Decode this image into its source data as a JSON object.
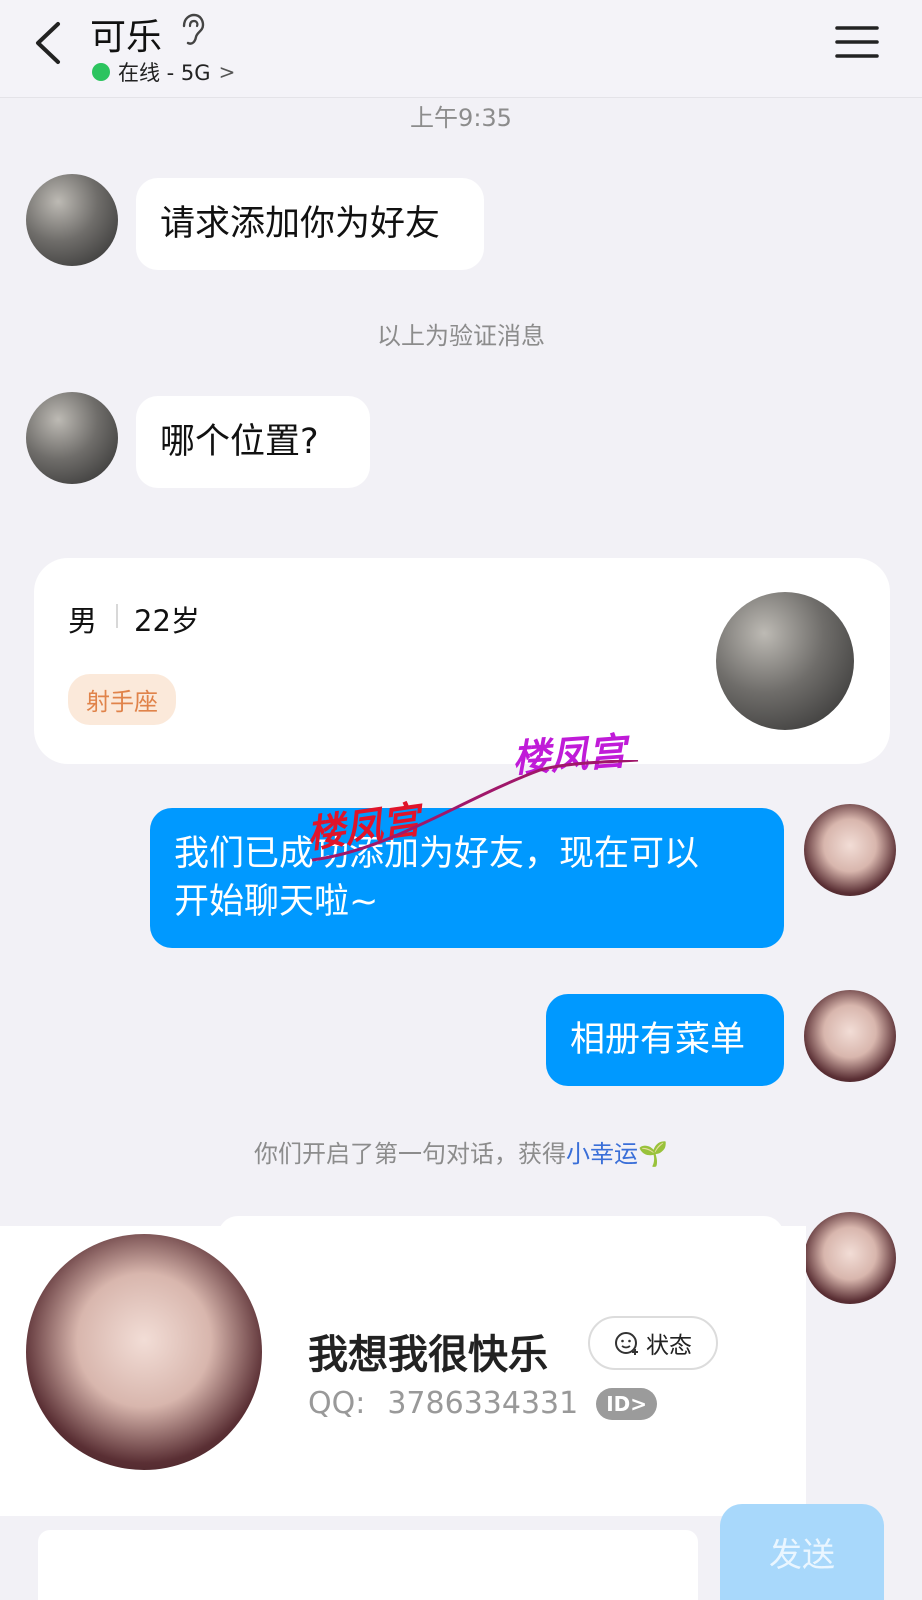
{
  "header": {
    "contact_name": "可乐",
    "status_text": "在线 - 5G",
    "status_chevron": ">"
  },
  "chat": {
    "timestamp": "上午9:35",
    "messages": [
      {
        "from": "them",
        "text": "请求添加你为好友"
      },
      {
        "from": "them",
        "text": "哪个位置?"
      },
      {
        "from": "me",
        "text_line1": "我们已成功添加为好友，现在可以",
        "text_line2": "开始聊天啦~"
      },
      {
        "from": "me",
        "text": "相册有菜单"
      }
    ],
    "verify_note": "以上为验证消息",
    "first_chat_note": "你们开启了第一句对话，获得",
    "lucky_link": "小幸运",
    "lucky_emoji": "🌱"
  },
  "profile_card": {
    "gender": "男",
    "age": "22岁",
    "zodiac": "射手座"
  },
  "watermarks": [
    "楼凤宫",
    "楼凤宫"
  ],
  "popup": {
    "nickname": "我想我很快乐",
    "state_label": "状态",
    "qq_label": "QQ:",
    "qq_number": "3786334331",
    "id_badge": "ID>"
  },
  "composer": {
    "send_label": "发送"
  },
  "colors": {
    "outgoing_bubble": "#0099ff",
    "online_dot": "#2cc45f",
    "zodiac_text": "#e0834a",
    "lucky_link": "#3a6fd8"
  }
}
